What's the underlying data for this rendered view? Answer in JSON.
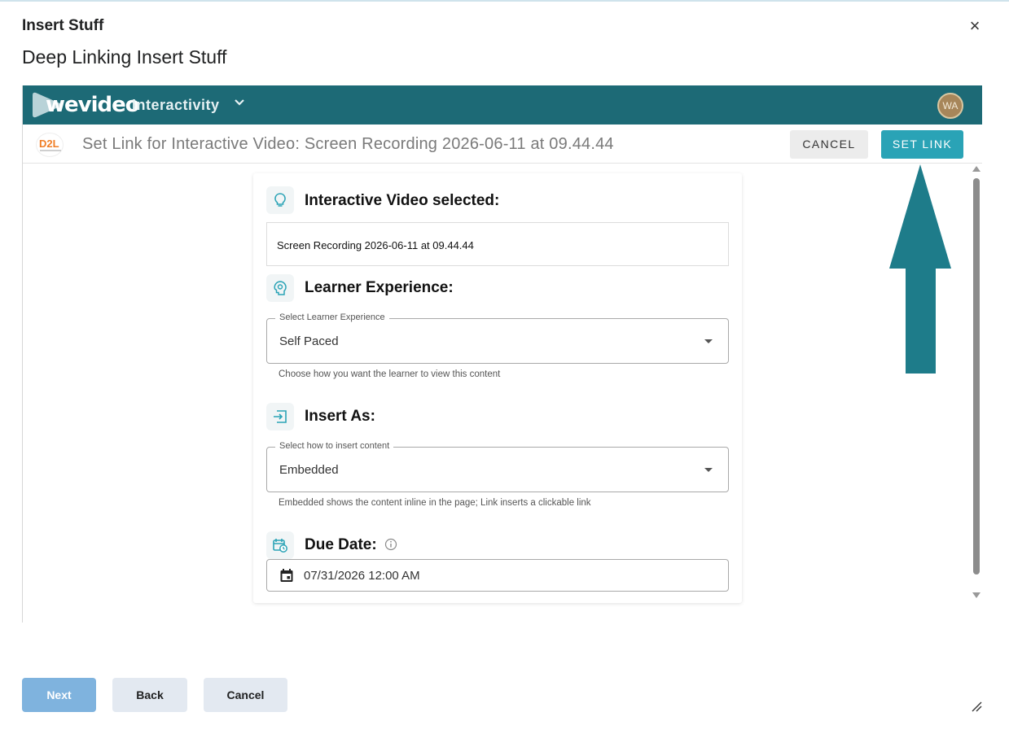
{
  "dialog": {
    "title": "Insert Stuff",
    "subtitle": "Deep Linking Insert Stuff",
    "close_glyph": "×"
  },
  "wevideo": {
    "logo_text": "wevideo",
    "nav_label": "Interactivity",
    "avatar_initials": "WA"
  },
  "subbar": {
    "brand_text": "D2L",
    "title": "Set Link for Interactive Video: Screen Recording 2026-06-11 at 09.44.44",
    "cancel_label": "CANCEL",
    "set_link_label": "SET LINK"
  },
  "form": {
    "video_section": {
      "title": "Interactive Video selected:",
      "value": "Screen Recording 2026-06-11 at 09.44.44",
      "icon": "lightbulb-icon"
    },
    "learner_section": {
      "title": "Learner Experience:",
      "icon": "head-bulb-icon",
      "field_label": "Select Learner Experience",
      "value": "Self Paced",
      "helper": "Choose how you want the learner to view this content"
    },
    "insert_section": {
      "title": "Insert As:",
      "icon": "insert-icon",
      "field_label": "Select how to insert content",
      "value": "Embedded",
      "helper": "Embedded shows the content inline in the page; Link inserts a clickable link"
    },
    "due_section": {
      "title": "Due Date:",
      "icon": "calendar-clock-icon",
      "value": "07/31/2026 12:00 AM"
    }
  },
  "footer": {
    "next_label": "Next",
    "back_label": "Back",
    "cancel_label": "Cancel"
  },
  "colors": {
    "accent": "#2aa3b6",
    "header": "#1d6a76",
    "arrow": "#1e7c8a",
    "next_button": "#7fb3de"
  }
}
